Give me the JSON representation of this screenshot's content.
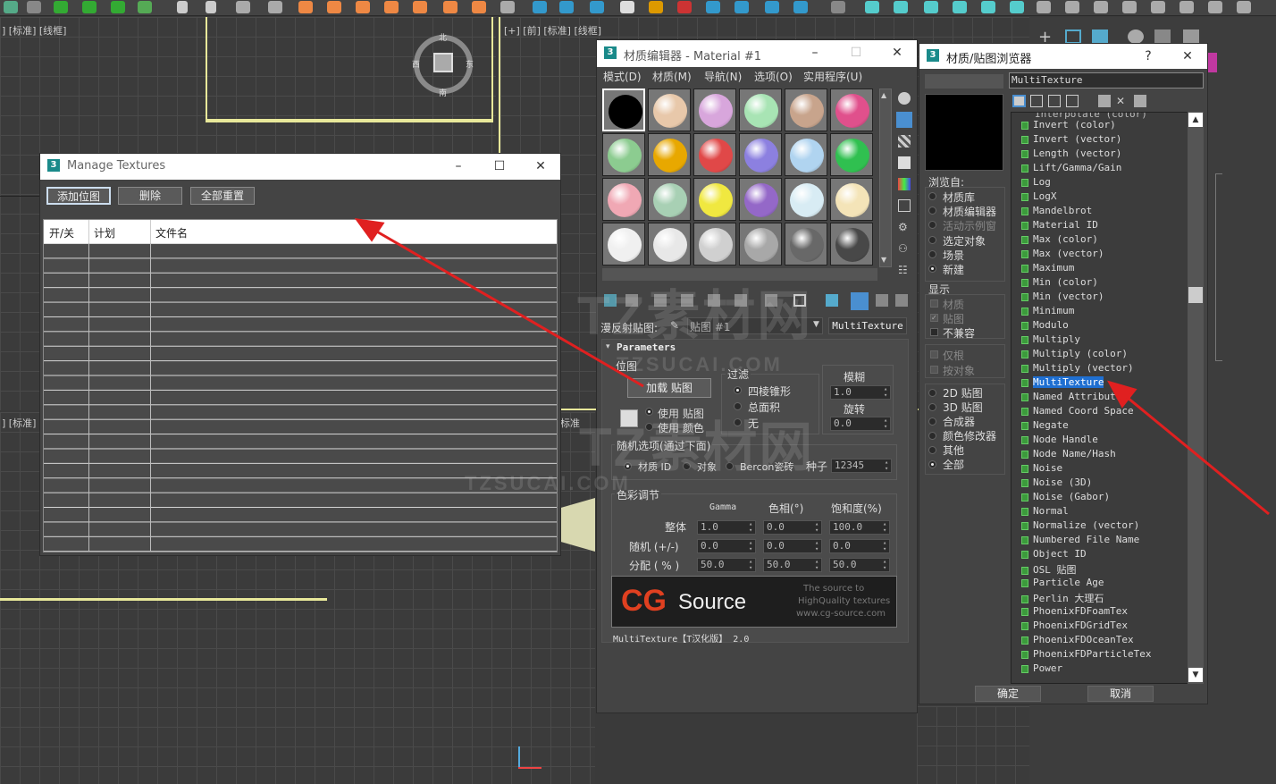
{
  "viewports": {
    "top_left_label": "] [标准] [线框]",
    "top_right_label": "[+] [前] [标准] [线框]",
    "bottom_left_label": "] [标准]",
    "bottom_mid_label": "标准",
    "compass": {
      "n": "北",
      "s": "南",
      "e": "东",
      "w": "西"
    }
  },
  "manage_textures": {
    "title": "Manage Textures",
    "add_bitmap": "添加位图",
    "delete": "删除",
    "reset_all": "全部重置",
    "columns": [
      "开/关",
      "计划",
      "文件名"
    ]
  },
  "material_editor": {
    "title": "材质编辑器 - Material #1",
    "menu": [
      "模式(D)",
      "材质(M)",
      "导航(N)",
      "选项(O)",
      "实用程序(U)"
    ],
    "diffuse_label": "漫反射贴图:",
    "map_name": "贴图 #1",
    "map_type": "MultiTexture",
    "rollout_title": "Parameters",
    "bitmap_group": "位图",
    "load_bitmap": "加载 贴图",
    "use_bitmap": "使用 贴图",
    "use_color": "使用 颜色",
    "filter_group": "过滤",
    "filter_pyramidal": "四棱锥形",
    "filter_sat": "总面积",
    "filter_none": "无",
    "blur_label": "模糊",
    "blur_value": "1.0",
    "rotate_label": "旋转",
    "rotate_value": "0.0",
    "random_group": "随机选项(通过下面)",
    "random_matid": "材质 ID",
    "random_object": "对象",
    "random_bercon": "Bercon瓷砖",
    "seed_label": "种子",
    "seed_value": "12345",
    "color_group": "色彩调节",
    "col_gamma": "Gamma",
    "col_hue": "色相(°)",
    "col_sat": "饱和度(%)",
    "row_overall": "整体",
    "row_random": "随机 (+/-)",
    "row_distrib": "分配 ( % )",
    "overall_values": [
      "1.0",
      "0.0",
      "100.0"
    ],
    "random_values": [
      "0.0",
      "0.0",
      "0.0"
    ],
    "distrib_values": [
      "50.0",
      "50.0",
      "50.0"
    ],
    "banner_cg": "CG",
    "banner_source": "Source",
    "banner_line1": "The source to",
    "banner_line2": "HighQuality textures",
    "banner_line3": "www.cg-source.com",
    "footer": "MultiTexture【T汉化版】 2.0",
    "sample_colors": [
      "#000000",
      "#e8c8aa",
      "#d8a6dc",
      "#a8e4b4",
      "#c8a48c",
      "#e0508c",
      "#8ccc90",
      "#e8a800",
      "#e04848",
      "#8c80e0",
      "#b0d4f0",
      "#30c050",
      "#f0a8b4",
      "#a8d0b4",
      "#f0e840",
      "#9468c8",
      "#d8ecf4",
      "#f4e4b8",
      "#f0f0f0",
      "#e8e8e8",
      "#d0d0d0",
      "#a8a8a8",
      "#686868",
      "#484848"
    ]
  },
  "browser": {
    "title": "材质/贴图浏览器",
    "help": "?",
    "search_value": "MultiTexture",
    "browse_from_title": "浏览自:",
    "browse_from": [
      "材质库",
      "材质编辑器",
      "活动示例窗",
      "选定对象",
      "场景",
      "新建"
    ],
    "show_title": "显示",
    "show_items": [
      "材质",
      "贴图",
      "不兼容"
    ],
    "only_root": "仅根",
    "by_object": "按对象",
    "types": [
      "2D 贴图",
      "3D 贴图",
      "合成器",
      "颜色修改器",
      "其他",
      "全部"
    ],
    "ok": "确定",
    "cancel": "取消",
    "items": [
      "Invert (color)",
      "Invert (vector)",
      "Length (vector)",
      "Lift/Gamma/Gain",
      "Log",
      "LogX",
      "Mandelbrot",
      "Material ID",
      "Max (color)",
      "Max (vector)",
      "Maximum",
      "Min (color)",
      "Min (vector)",
      "Minimum",
      "Modulo",
      "Multiply",
      "Multiply (color)",
      "Multiply (vector)",
      "MultiTexture",
      "Named Attribute",
      "Named Coord Space",
      "Negate",
      "Node Handle",
      "Node Name/Hash",
      "Noise",
      "Noise (3D)",
      "Noise (Gabor)",
      "Normal",
      "Normalize (vector)",
      "Numbered File Name",
      "Object ID",
      "OSL 贴图",
      "Particle Age",
      "Perlin 大理石",
      "PhoenixFDFoamTex",
      "PhoenixFDGridTex",
      "PhoenixFDOceanTex",
      "PhoenixFDParticleTex",
      "Power"
    ],
    "selected": "MultiTexture",
    "partial_top": "Interpolate (color)"
  },
  "watermark": {
    "line1": "TZ素材网",
    "line2": "TZSUCAI.COM"
  },
  "accent": "#e02020"
}
